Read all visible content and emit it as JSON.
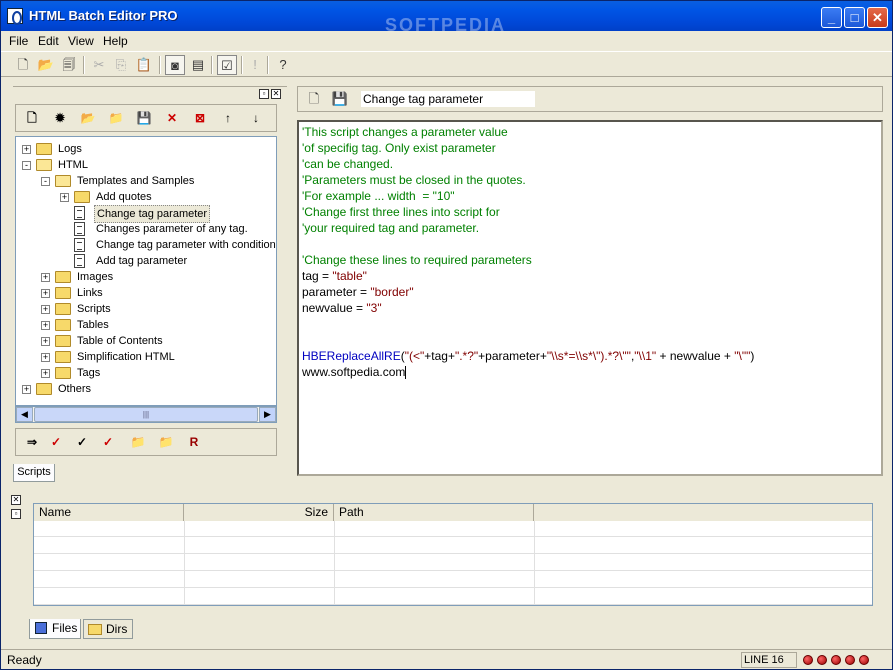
{
  "window": {
    "title": "HTML Batch Editor PRO",
    "watermark": "SOFTPEDIA",
    "watermark_url": "www.softpedia.com"
  },
  "menu": [
    "File",
    "Edit",
    "View",
    "Help"
  ],
  "tree": [
    {
      "label": "Logs",
      "level": 0,
      "kind": "folder",
      "expander": "+"
    },
    {
      "label": "HTML",
      "level": 0,
      "kind": "folder-open",
      "expander": "-"
    },
    {
      "label": "Templates and Samples",
      "level": 1,
      "kind": "folder-open",
      "expander": "-"
    },
    {
      "label": "Add quotes",
      "level": 2,
      "kind": "folder",
      "expander": "+"
    },
    {
      "label": "Change tag parameter",
      "level": 2,
      "kind": "doc",
      "selected": true
    },
    {
      "label": "Changes parameter of any tag.",
      "level": 2,
      "kind": "doc"
    },
    {
      "label": "Change tag parameter with condition",
      "level": 2,
      "kind": "doc"
    },
    {
      "label": "Add tag parameter",
      "level": 2,
      "kind": "doc"
    },
    {
      "label": "Images",
      "level": 1,
      "kind": "folder",
      "expander": "+"
    },
    {
      "label": "Links",
      "level": 1,
      "kind": "folder",
      "expander": "+"
    },
    {
      "label": "Scripts",
      "level": 1,
      "kind": "folder",
      "expander": "+"
    },
    {
      "label": "Tables",
      "level": 1,
      "kind": "folder",
      "expander": "+"
    },
    {
      "label": "Table of Contents",
      "level": 1,
      "kind": "folder",
      "expander": "+"
    },
    {
      "label": "Simplification HTML",
      "level": 1,
      "kind": "folder",
      "expander": "+"
    },
    {
      "label": "Tags",
      "level": 1,
      "kind": "folder",
      "expander": "+"
    },
    {
      "label": "Others",
      "level": 0,
      "kind": "folder",
      "expander": "+"
    }
  ],
  "scripts_tab": "Scripts",
  "editor": {
    "script_name": "Change tag parameter",
    "lines": [
      [
        {
          "t": "'This script changes a parameter value",
          "c": "comment"
        }
      ],
      [
        {
          "t": "'of specifig tag. Only exist parameter",
          "c": "comment"
        }
      ],
      [
        {
          "t": "'can be changed.",
          "c": "comment"
        }
      ],
      [
        {
          "t": "'Parameters must be closed in the quotes.",
          "c": "comment"
        }
      ],
      [
        {
          "t": "'For example ... width  = \"10\"",
          "c": "comment"
        }
      ],
      [
        {
          "t": "'Change first three lines into script for",
          "c": "comment"
        }
      ],
      [
        {
          "t": "'your required tag and parameter.",
          "c": "comment"
        }
      ],
      [],
      [
        {
          "t": "'Change these lines to required parameters",
          "c": "comment"
        }
      ],
      [
        {
          "t": "tag = ",
          "c": "plain"
        },
        {
          "t": "\"table\"",
          "c": "string"
        }
      ],
      [
        {
          "t": "parameter = ",
          "c": "plain"
        },
        {
          "t": "\"border\"",
          "c": "string"
        }
      ],
      [
        {
          "t": "newvalue = ",
          "c": "plain"
        },
        {
          "t": "\"3\"",
          "c": "string"
        }
      ],
      [],
      [],
      [
        {
          "t": "HBEReplaceAllRE",
          "c": "func"
        },
        {
          "t": "(",
          "c": "plain"
        },
        {
          "t": "\"(<\"",
          "c": "string"
        },
        {
          "t": "+tag+",
          "c": "plain"
        },
        {
          "t": "\".*?\"",
          "c": "string"
        },
        {
          "t": "+parameter+",
          "c": "plain"
        },
        {
          "t": "\"\\\\s*=\\\\s*\\\").*?\\\"\"",
          "c": "string"
        },
        {
          "t": ",",
          "c": "plain"
        },
        {
          "t": "\"\\\\1\"",
          "c": "string"
        },
        {
          "t": " + newvalue + ",
          "c": "plain"
        },
        {
          "t": "\"\\\"\"",
          "c": "string"
        },
        {
          "t": ")",
          "c": "plain"
        }
      ],
      [
        {
          "t": "www.softpedia.com",
          "c": "plain"
        }
      ]
    ]
  },
  "files_list": {
    "columns": [
      "Name",
      "Size",
      "Path"
    ]
  },
  "bottom_tabs": [
    "Files",
    "Dirs"
  ],
  "status": {
    "text": "Ready",
    "line": "LINE 16"
  }
}
